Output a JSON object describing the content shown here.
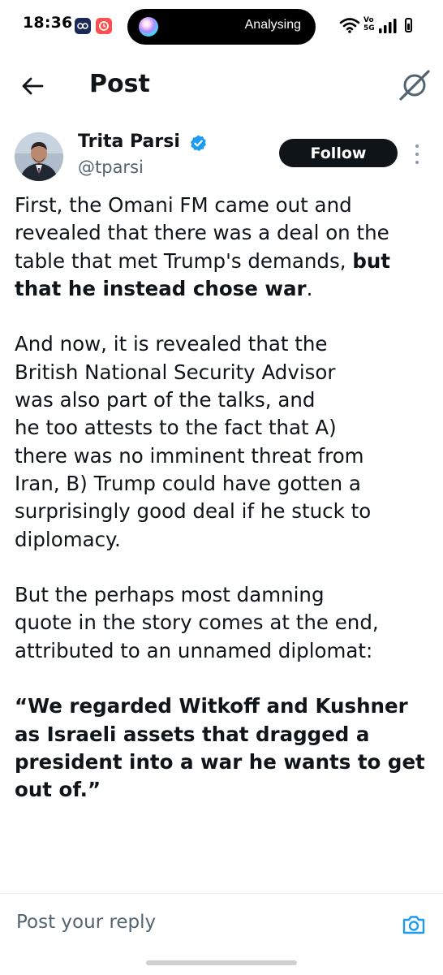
{
  "status_bar": {
    "time": "18:36",
    "activity_text": "Analysing",
    "network_label_top": "Vo",
    "network_label_bottom": "5G"
  },
  "header": {
    "title": "Post",
    "back_icon": "arrow-left-icon",
    "grok_icon": "grok-icon"
  },
  "author": {
    "name": "Trita Parsi",
    "handle": "@tparsi",
    "verified": true,
    "follow_label": "Follow"
  },
  "post": {
    "paragraphs": [
      [
        [
          {
            "t": "First, the Omani FM came out and",
            "b": false
          }
        ],
        [
          {
            "t": "revealed that there was a deal on the",
            "b": false
          }
        ],
        [
          {
            "t": "table that met Trump's demands, ",
            "b": false
          },
          {
            "t": "but",
            "b": true
          }
        ],
        [
          {
            "t": "that he instead chose war",
            "b": true
          },
          {
            "t": ".",
            "b": false
          }
        ]
      ],
      [
        [
          {
            "t": "And now, it is revealed that the",
            "b": false
          }
        ],
        [
          {
            "t": "British National Security Advisor",
            "b": false
          }
        ],
        [
          {
            "t": "was also part of the talks, and",
            "b": false
          }
        ],
        [
          {
            "t": "he too attests to the fact that A)",
            "b": false
          }
        ],
        [
          {
            "t": "there was no imminent threat from",
            "b": false
          }
        ],
        [
          {
            "t": "Iran, B) Trump could have gotten a",
            "b": false
          }
        ],
        [
          {
            "t": "surprisingly good deal if he stuck to",
            "b": false
          }
        ],
        [
          {
            "t": "diplomacy.",
            "b": false
          }
        ]
      ],
      [
        [
          {
            "t": "But the perhaps most damning",
            "b": false
          }
        ],
        [
          {
            "t": "quote in the story comes at the end,",
            "b": false
          }
        ],
        [
          {
            "t": "attributed to an unnamed diplomat:",
            "b": false
          }
        ]
      ],
      [
        [
          {
            "t": "“We regarded Witkoff and Kushner",
            "b": true
          }
        ],
        [
          {
            "t": "as Israeli assets that dragged a",
            "b": true
          }
        ],
        [
          {
            "t": "president into a war he wants to get",
            "b": true
          }
        ],
        [
          {
            "t": "out of.”",
            "b": true
          }
        ]
      ]
    ]
  },
  "reply": {
    "placeholder": "Post your reply",
    "camera_icon": "camera-icon"
  },
  "colors": {
    "text": "#0f1419",
    "secondary_text": "#536471",
    "verified_blue": "#1d9bf0",
    "follow_bg": "#0f1419",
    "camera_blue": "#1d9bf0"
  }
}
